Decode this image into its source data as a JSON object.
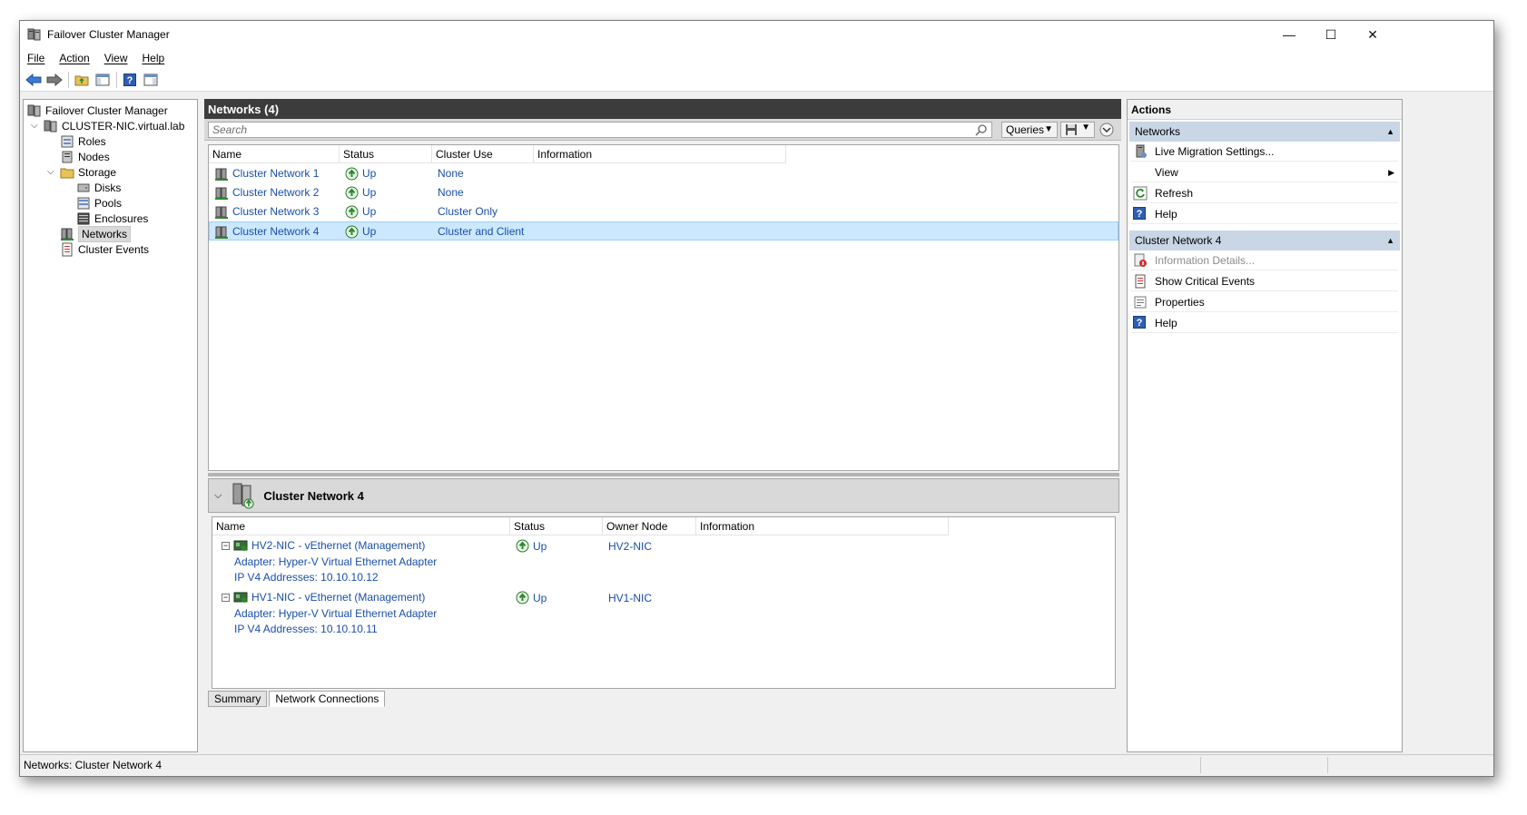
{
  "window": {
    "title": "Failover Cluster Manager",
    "minimize_glyph": "—",
    "maximize_glyph": "☐",
    "close_glyph": "✕"
  },
  "menu": {
    "items": [
      {
        "label": "File",
        "key": "F"
      },
      {
        "label": "Action",
        "key": "A"
      },
      {
        "label": "View",
        "key": "V"
      },
      {
        "label": "Help",
        "key": "H"
      }
    ]
  },
  "tree": {
    "root": "Failover Cluster Manager",
    "cluster": "CLUSTER-NIC.virtual.lab",
    "roles": "Roles",
    "nodes": "Nodes",
    "storage": "Storage",
    "disks": "Disks",
    "pools": "Pools",
    "enclosures": "Enclosures",
    "networks": "Networks",
    "cluster_events": "Cluster Events"
  },
  "center": {
    "header": "Networks (4)",
    "search_placeholder": "Search",
    "queries_label": "Queries",
    "columns": [
      "Name",
      "Status",
      "Cluster Use",
      "Information"
    ],
    "rows": [
      {
        "name": "Cluster Network 1",
        "status": "Up",
        "use": "None",
        "info": ""
      },
      {
        "name": "Cluster Network 2",
        "status": "Up",
        "use": "None",
        "info": ""
      },
      {
        "name": "Cluster Network 3",
        "status": "Up",
        "use": "Cluster Only",
        "info": ""
      },
      {
        "name": "Cluster Network 4",
        "status": "Up",
        "use": "Cluster and Client",
        "info": ""
      }
    ]
  },
  "detail": {
    "title": "Cluster Network 4",
    "columns": [
      "Name",
      "Status",
      "Owner Node",
      "Information"
    ],
    "connections": [
      {
        "name": "HV2-NIC - vEthernet (Management)",
        "adapter": "Adapter: Hyper-V Virtual Ethernet Adapter",
        "ip": "IP V4 Addresses: 10.10.10.12",
        "status": "Up",
        "owner": "HV2-NIC"
      },
      {
        "name": "HV1-NIC - vEthernet (Management)",
        "adapter": "Adapter: Hyper-V Virtual Ethernet Adapter",
        "ip": "IP V4 Addresses: 10.10.10.11",
        "status": "Up",
        "owner": "HV1-NIC"
      }
    ],
    "tabs": [
      "Summary",
      "Network Connections"
    ]
  },
  "actions": {
    "title": "Actions",
    "section1": "Networks",
    "section1_items": [
      "Live Migration Settings...",
      "View",
      "Refresh",
      "Help"
    ],
    "section2": "Cluster Network 4",
    "section2_items": [
      "Information Details...",
      "Show Critical Events",
      "Properties",
      "Help"
    ]
  },
  "statusbar": {
    "text": "Networks:  Cluster Network 4"
  },
  "colors": {
    "selection": "#cce8ff",
    "section_header": "#c8d6e6",
    "link": "#1a4fa8",
    "header_dark": "#3c3c3c"
  }
}
